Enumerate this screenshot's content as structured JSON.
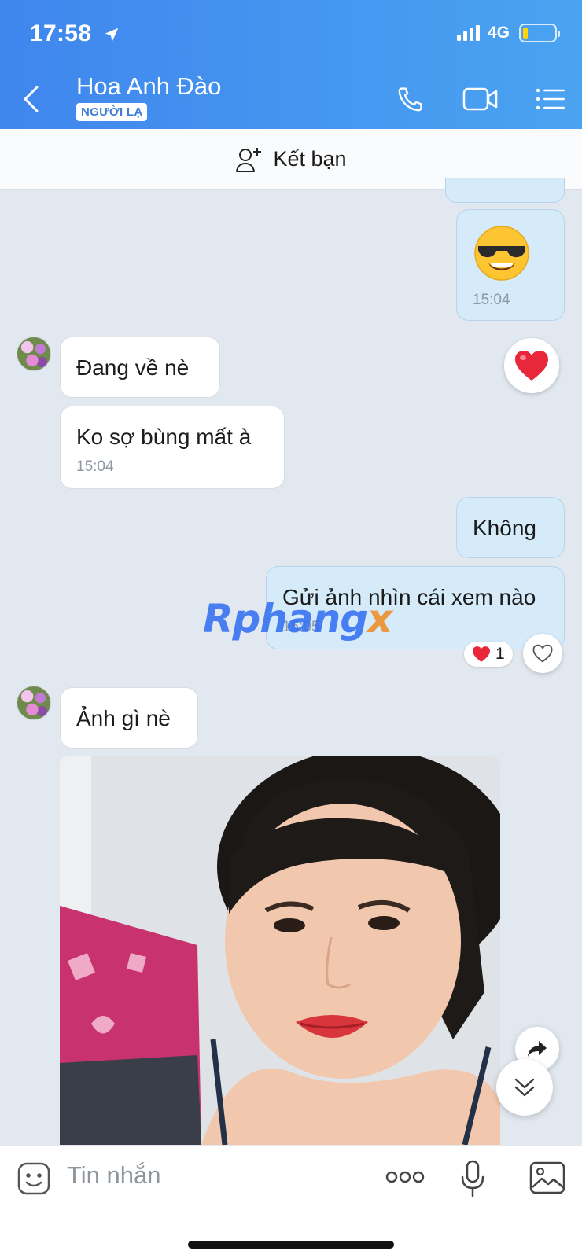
{
  "status_bar": {
    "time": "17:58",
    "network": "4G"
  },
  "header": {
    "contact_name": "Hoa Anh Đào",
    "badge": "NGƯỜI LẠ"
  },
  "friend_bar": {
    "label": "Kết bạn"
  },
  "messages": {
    "emoji_time": "15:04",
    "in1": "Đang về nè",
    "in2": "Ko sợ bùng mất à",
    "in2_time": "15:04",
    "out1": "Không",
    "out2": "Gửi ảnh nhìn cái xem nào",
    "out2_time": "15:05",
    "out2_reaction_count": "1",
    "in3": "Ảnh gì nè"
  },
  "watermark": {
    "main": "Rphang",
    "accent": "x"
  },
  "input": {
    "placeholder": "Tin nhắn"
  },
  "colors": {
    "header_start": "#3f86ee",
    "header_end": "#4aa3f1",
    "outgoing_bubble": "#d5ebfa",
    "background": "#e2e8f0"
  }
}
